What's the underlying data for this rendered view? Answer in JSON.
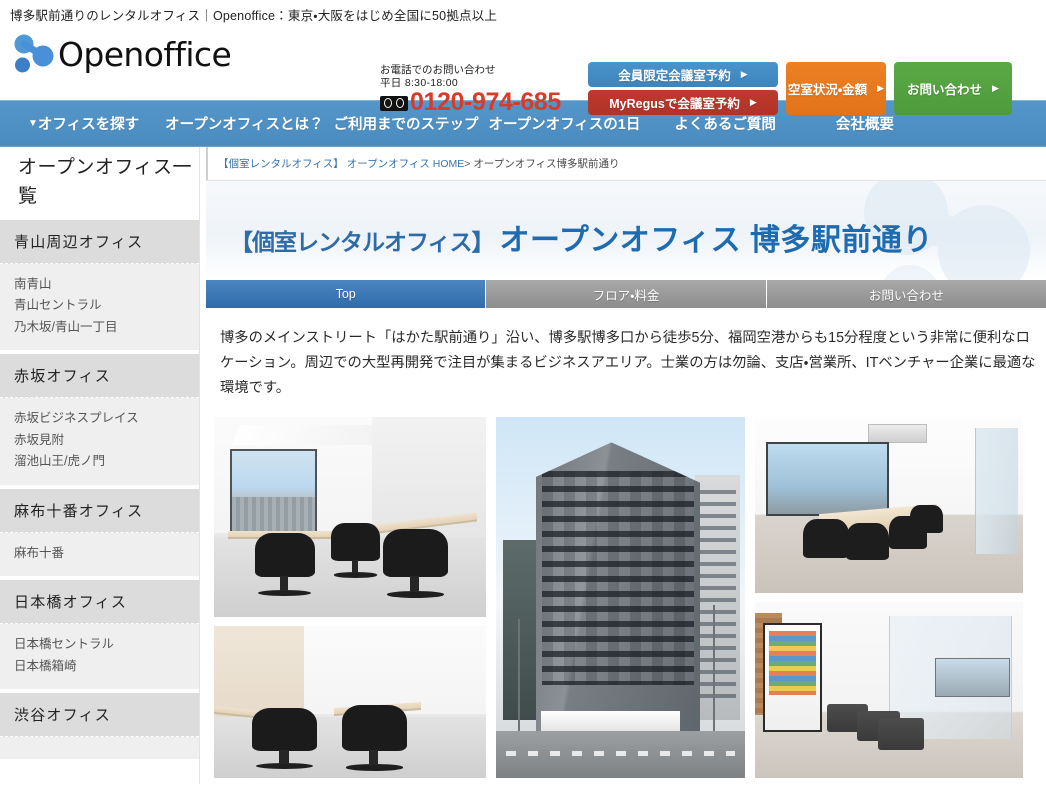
{
  "tagline": "博多駅前通りのレンタルオフィス｜Openoffice：東京・大阪をはじめ全国に50拠点以上",
  "brand": {
    "name": "Openoffice",
    "mark_color": "#4a90d9"
  },
  "contact": {
    "label": "お電話でのお問い合わせ",
    "hours": "平日 8:30-18:00",
    "phone": "0120-974-685",
    "phone_color": "#d93b2b"
  },
  "cta": {
    "member_reserve": "会員限定会議室予約",
    "myregus_reserve": "MyRegusで会議室予約",
    "availability": "空室状況・金額",
    "contact": "お問い合わせ",
    "arrow": "▶",
    "colors": {
      "blue": "#4a93cb",
      "red": "#c0392b",
      "orange": "#ec8023",
      "green": "#5aa845"
    }
  },
  "nav": {
    "caret": "▼",
    "items": [
      "オフィスを探す",
      "オープンオフィスとは？",
      "ご利用までのステップ",
      "オープンオフィスの1日",
      "よくあるご質問",
      "会社概要"
    ],
    "bg_color": "#5496c9"
  },
  "sidebar": {
    "title": "オープンオフィス一覧",
    "groups": [
      {
        "heading": "青山周辺オフィス",
        "links": [
          "南青山",
          "青山セントラル",
          "乃木坂/青山一丁目"
        ]
      },
      {
        "heading": "赤坂オフィス",
        "links": [
          "赤坂ビジネスプレイス",
          "赤坂見附",
          "溜池山王/虎ノ門"
        ]
      },
      {
        "heading": "麻布十番オフィス",
        "links": [
          "麻布十番"
        ]
      },
      {
        "heading": "日本橋オフィス",
        "links": [
          "日本橋セントラル",
          "日本橋箱崎"
        ]
      },
      {
        "heading": "渋谷オフィス",
        "links": []
      }
    ]
  },
  "breadcrumb": {
    "bracket": "【個室レンタルオフィス】",
    "home": "オープンオフィス HOME",
    "separator": ">",
    "current": "オープンオフィス博多駅前通り"
  },
  "hero": {
    "prefix": "【個室レンタルオフィス】",
    "title": "オープンオフィス 博多駅前通り",
    "accent_color": "#1f6bb0"
  },
  "tabs": [
    {
      "label": "Top",
      "active": true
    },
    {
      "label": "フロア・料金",
      "active": false
    },
    {
      "label": "お問い合わせ",
      "active": false
    }
  ],
  "description": "博多のメインストリート「はかた駅前通り」沿い、博多駅博多口から徒歩5分、福岡空港からも15分程度という非常に便利なロケーション。周辺での大型再開発で注目が集まるビジネスアエリア。士業の方は勿論、支店・営業所、ITベンチャー企業に最適な環境です。",
  "gallery": {
    "photos": [
      {
        "id": "private-office-window",
        "alt": "個室オフィス 窓側デスク"
      },
      {
        "id": "private-office-desks",
        "alt": "個室オフィス デスク2台"
      },
      {
        "id": "building-exterior",
        "alt": "ビル外観 博多駅前通り"
      },
      {
        "id": "meeting-room",
        "alt": "会議室"
      },
      {
        "id": "lounge-vending",
        "alt": "ラウンジ・自動販売機"
      }
    ]
  }
}
